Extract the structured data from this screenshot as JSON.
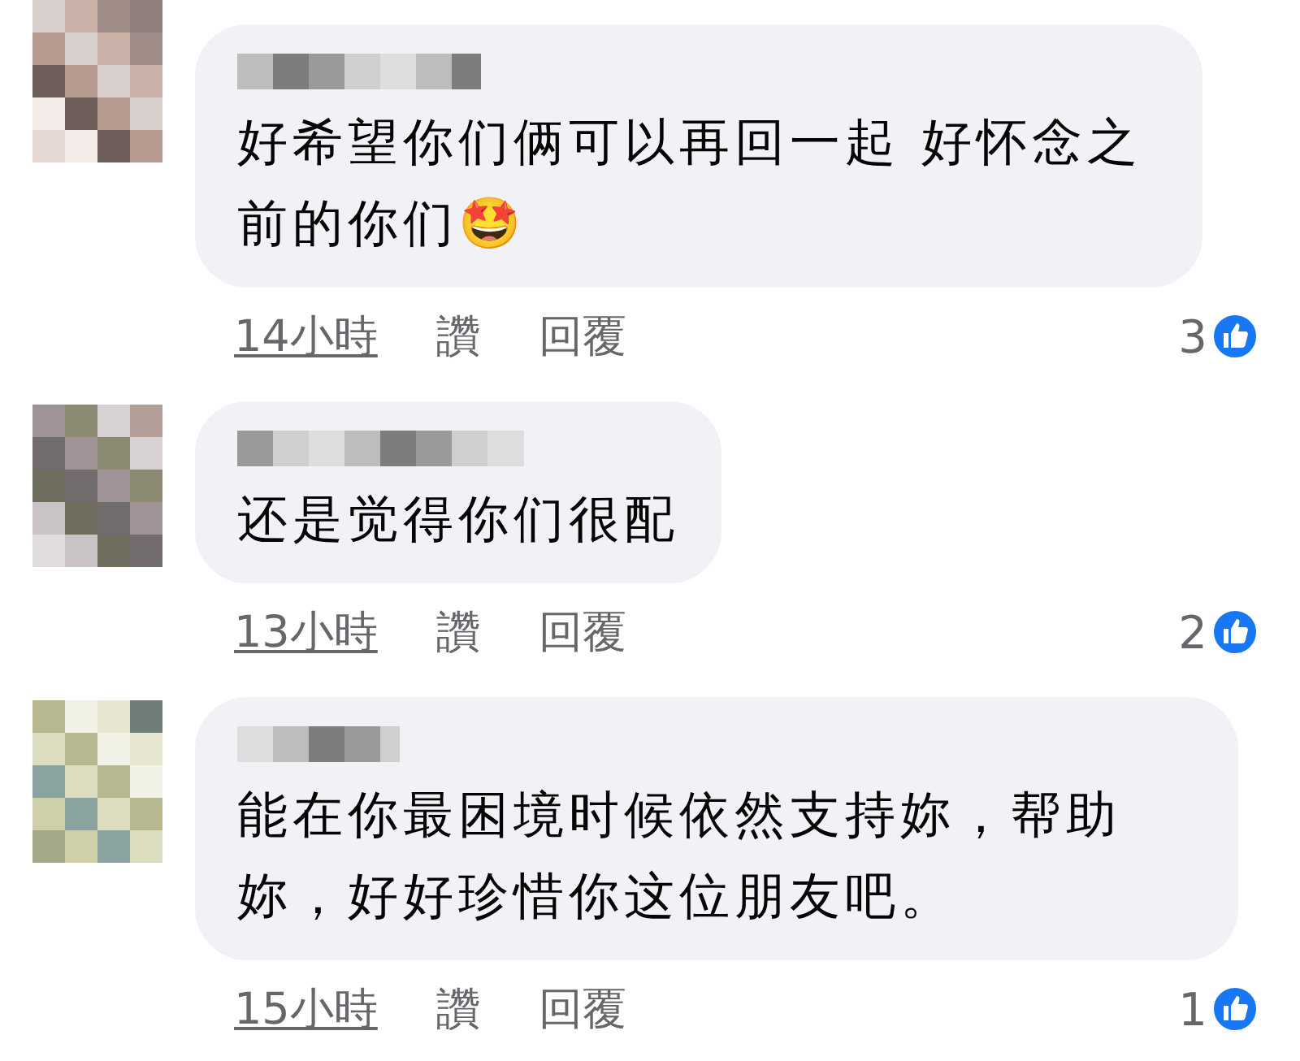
{
  "comments": [
    {
      "text": "好希望你们俩可以再回一起 好怀念之前的你们🤩",
      "time": "14小時",
      "like": "讚",
      "reply": "回覆",
      "reactions": "3"
    },
    {
      "text": "还是觉得你们很配",
      "time": "13小時",
      "like": "讚",
      "reply": "回覆",
      "reactions": "2"
    },
    {
      "text": "能在你最困境时候依然支持妳，帮助妳，好好珍惜你这位朋友吧。",
      "time": "15小時",
      "like": "讚",
      "reply": "回覆",
      "reactions": "1"
    }
  ]
}
